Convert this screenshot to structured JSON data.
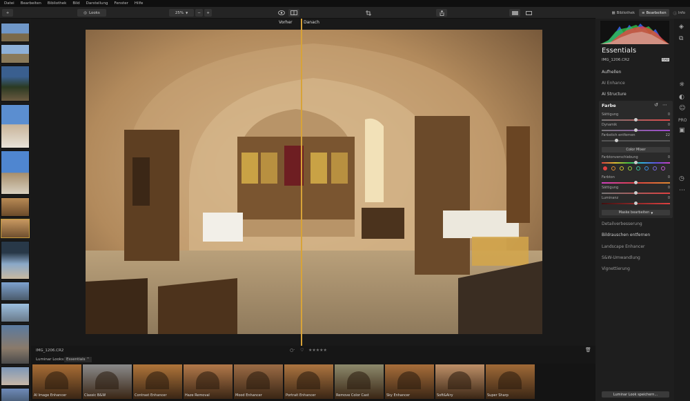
{
  "menu": [
    "Datei",
    "Bearbeiten",
    "Bibliothek",
    "Bild",
    "Darstellung",
    "Fenster",
    "Hilfe"
  ],
  "toolbar": {
    "add": "+",
    "looks": "Looks",
    "zoom": "25%",
    "minus": "−",
    "plus": "+"
  },
  "tabs": [
    {
      "label": "Bibliothek"
    },
    {
      "label": "Bearbeiten"
    },
    {
      "label": "Info"
    }
  ],
  "compare": {
    "before": "Vorher",
    "after": "Danach"
  },
  "status": {
    "filename": "IMG_1206.CR2",
    "stars": "★★★★★"
  },
  "luminar_looks": {
    "label": "Luminar Looks:",
    "category": "Essentials",
    "save_button": "Luminar Look speichern..."
  },
  "looks": [
    {
      "name": "AI Image Enhancer",
      "tone": "#a86d35"
    },
    {
      "name": "Classic B&W",
      "tone": "#8a8a8a"
    },
    {
      "name": "Contrast Enhancer",
      "tone": "#b0753a"
    },
    {
      "name": "Haze Removal",
      "tone": "#b3794a"
    },
    {
      "name": "Mood Enhancer",
      "tone": "#9c6c45"
    },
    {
      "name": "Portrait Enhancer",
      "tone": "#ad7540"
    },
    {
      "name": "Remove Color Cast",
      "tone": "#8d8a6c"
    },
    {
      "name": "Sky Enhancer",
      "tone": "#a86e3a"
    },
    {
      "name": "Soft&Airy",
      "tone": "#bf9068"
    },
    {
      "name": "Super Sharp",
      "tone": "#a06a37"
    }
  ],
  "panel": {
    "title": "Essentials",
    "filename": "IMG_1206.CR2",
    "badge": "RAW",
    "sections_top": [
      "Aufhellen",
      "AI Enhance",
      "AI Structure"
    ],
    "color_card": {
      "title": "Farbe",
      "sliders_a": [
        {
          "label": "Sättigung",
          "value": "0",
          "pos": 0.5
        },
        {
          "label": "Dynamik",
          "value": "0",
          "pos": 0.5
        },
        {
          "label": "Farbstich entfernen",
          "value": "22",
          "pos": 0.22
        }
      ],
      "color_mixer": "Color Mixer",
      "hue_shift": {
        "label": "Farbtonverschiebung",
        "value": "0",
        "pos": 0.5
      },
      "swatches": [
        "#e04040",
        "#e08a30",
        "#d8c630",
        "#9ad13a",
        "#35c4a0",
        "#3a8ee0",
        "#7a6ae0",
        "#c75ad8"
      ],
      "sliders_b": [
        {
          "label": "Farbton",
          "value": "0",
          "pos": 0.5
        },
        {
          "label": "Sättigung",
          "value": "0",
          "pos": 0.5
        },
        {
          "label": "Luminanz",
          "value": "0",
          "pos": 0.5
        }
      ],
      "mask_button": "Maske bearbeiten"
    },
    "sections_bottom": [
      "Detailverbesserung",
      "Bildrauschen entfernen",
      "Landscape Enhancer",
      "S&W-Umwandlung",
      "Vignettierung"
    ]
  }
}
